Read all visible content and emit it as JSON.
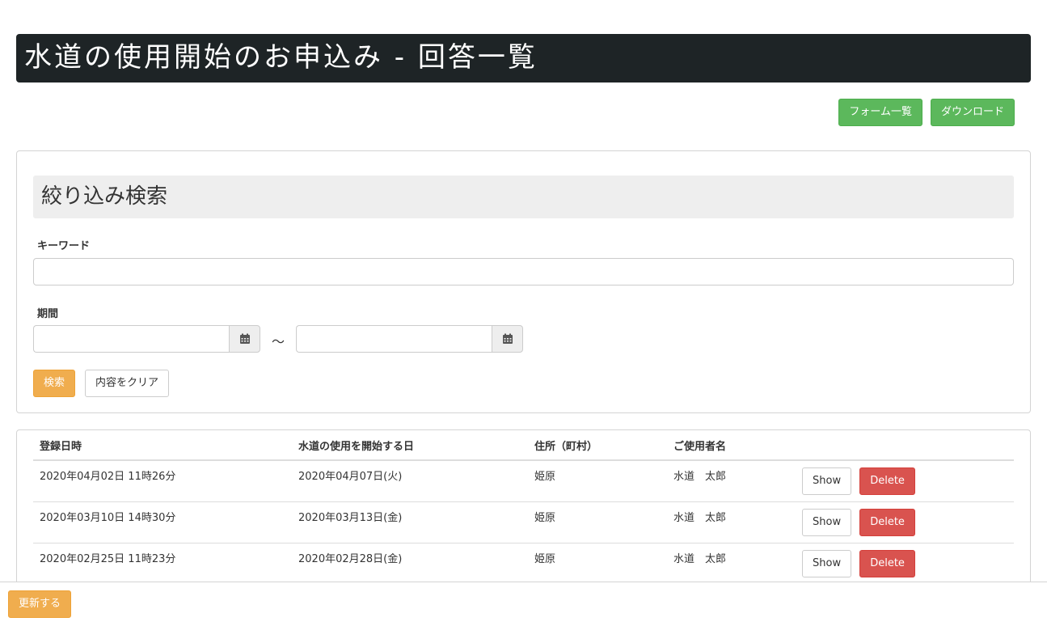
{
  "page": {
    "title": "水道の使用開始のお申込み - 回答一覧"
  },
  "top_actions": {
    "form_list_label": "フォーム一覧",
    "download_label": "ダウンロード"
  },
  "search": {
    "heading": "絞り込み検索",
    "keyword_label": "キーワード",
    "keyword_value": "",
    "period_label": "期間",
    "date_from_value": "",
    "date_to_value": "",
    "separator": "～",
    "search_button_label": "検索",
    "clear_button_label": "内容をクリア"
  },
  "table": {
    "columns": [
      "登録日時",
      "水道の使用を開始する日",
      "住所（町村）",
      "ご使用者名"
    ],
    "rows": [
      {
        "registered": "2020年04月02日 11時26分",
        "start_date": "2020年04月07日(火)",
        "address": "姫原",
        "user_name": "水道　太郎"
      },
      {
        "registered": "2020年03月10日 14時30分",
        "start_date": "2020年03月13日(金)",
        "address": "姫原",
        "user_name": "水道　太郎"
      },
      {
        "registered": "2020年02月25日 11時23分",
        "start_date": "2020年02月28日(金)",
        "address": "姫原",
        "user_name": "水道　太郎"
      }
    ],
    "show_label": "Show",
    "delete_label": "Delete"
  },
  "footer": {
    "update_label": "更新する"
  },
  "colors": {
    "title_bar_bg": "#1e2426",
    "success": "#5cb85c",
    "warning": "#f0ad4e",
    "danger": "#d9534f"
  }
}
